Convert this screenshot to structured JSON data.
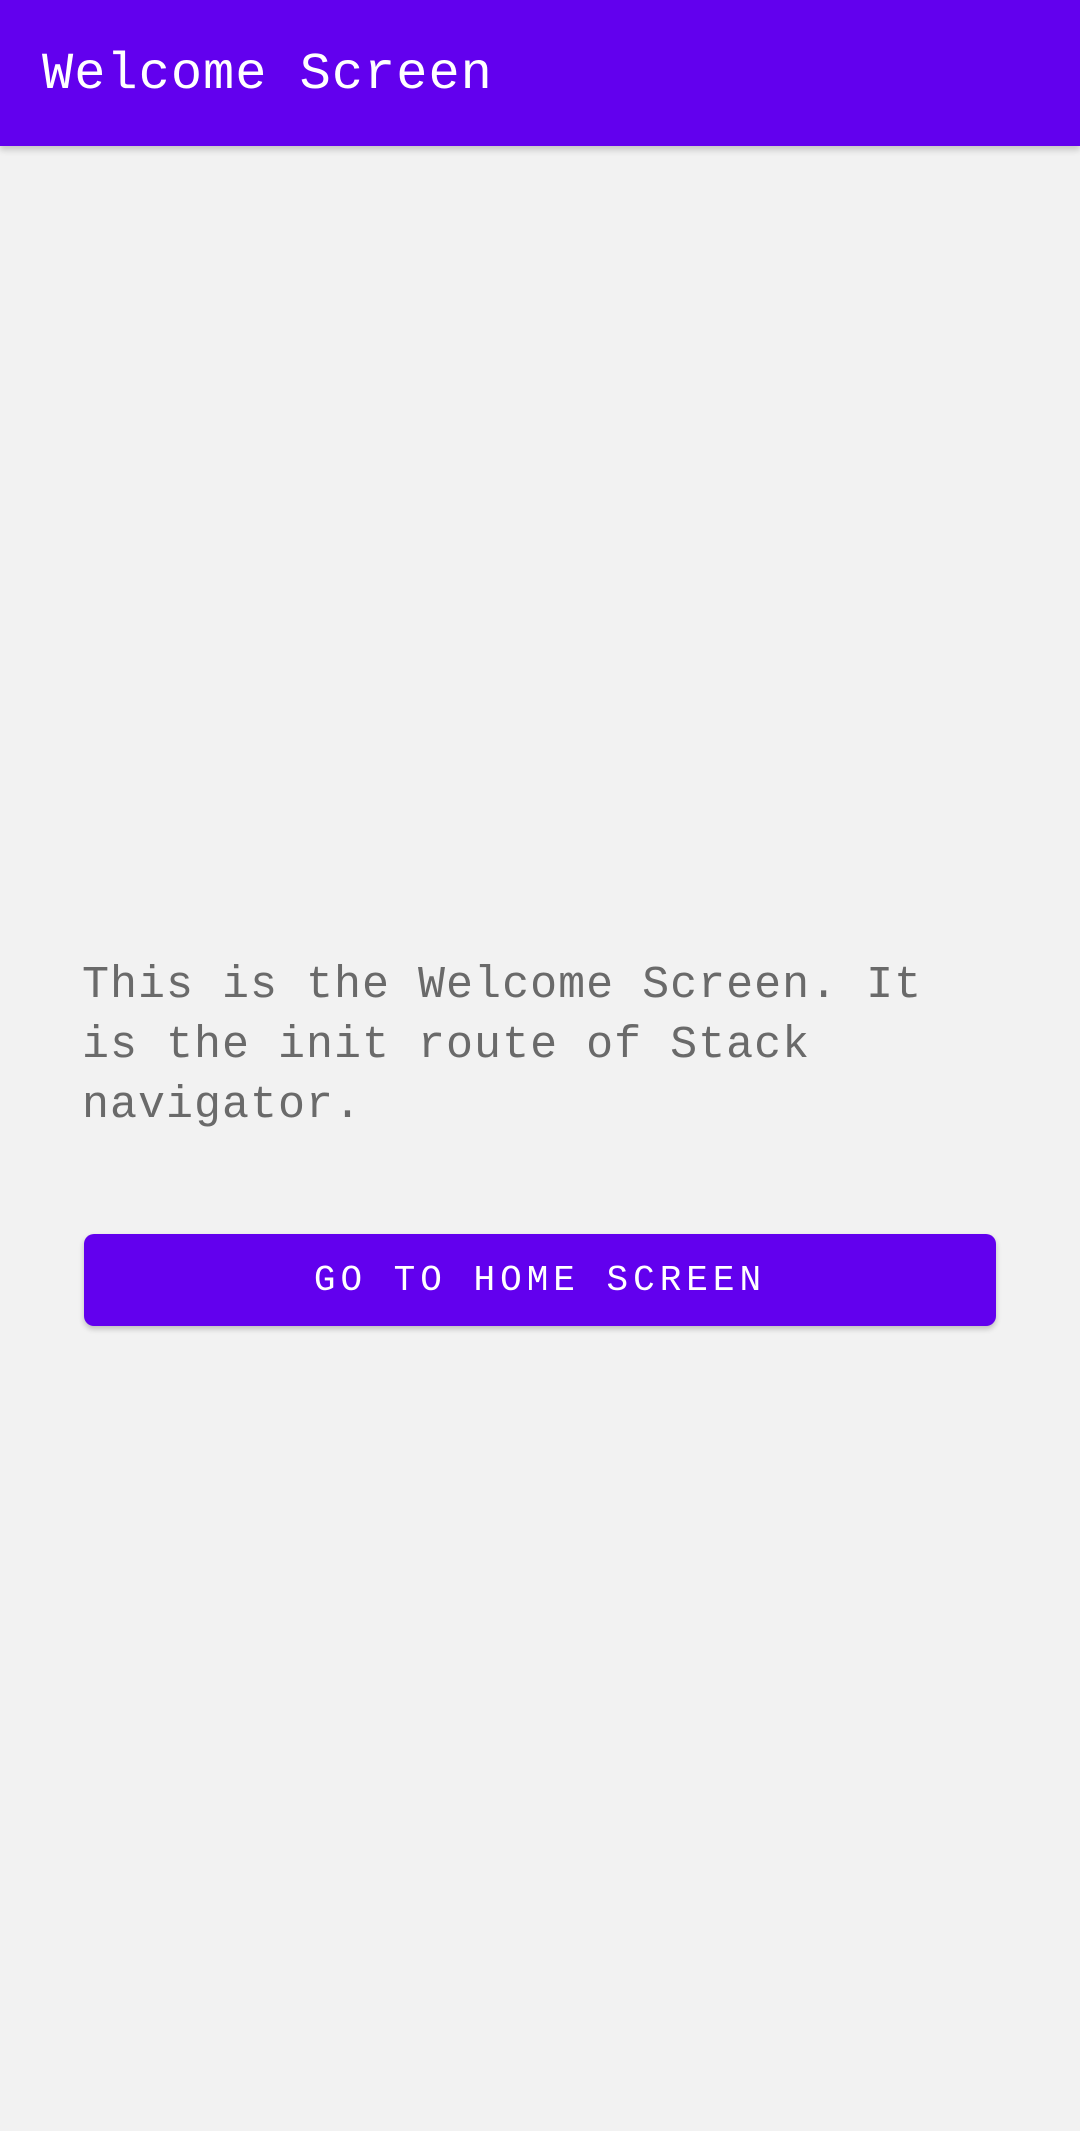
{
  "app_bar": {
    "title": "Welcome Screen"
  },
  "main": {
    "description": "This is the Welcome Screen. It is the init route of Stack navigator.",
    "button_label": "GO TO HOME SCREEN"
  },
  "colors": {
    "primary": "#6200ee",
    "background": "#f2f2f2",
    "body_text": "#6a6a6a",
    "on_primary": "#ffffff"
  }
}
